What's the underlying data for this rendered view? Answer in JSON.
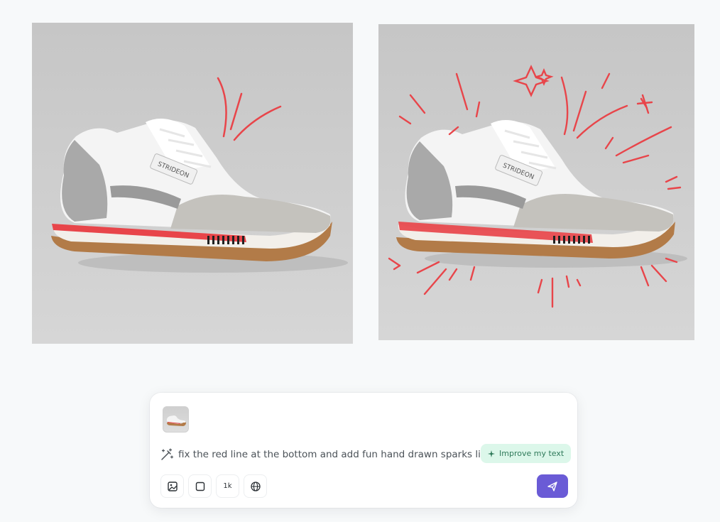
{
  "images": {
    "original": {
      "alt": "original-shoe-image",
      "brand_label": "STRIDEON"
    },
    "edited": {
      "alt": "edited-shoe-image",
      "brand_label": "STRIDEON"
    }
  },
  "composer": {
    "prompt_text": "fix the red line at the bottom and add fun hand drawn sparks like the",
    "improve_button_label": "Improve my text",
    "toolbar": {
      "image_tool": "image-icon",
      "aspect_tool": "square-icon",
      "resolution_label": "1k",
      "language_tool": "globe-icon"
    },
    "send_button": "send-icon"
  },
  "colors": {
    "accent": "#6a5bd6",
    "improve_bg": "#dcf7ea",
    "improve_text": "#2f7a5a",
    "sketch_red": "#e8454a",
    "page_bg": "#f7f9fa"
  }
}
